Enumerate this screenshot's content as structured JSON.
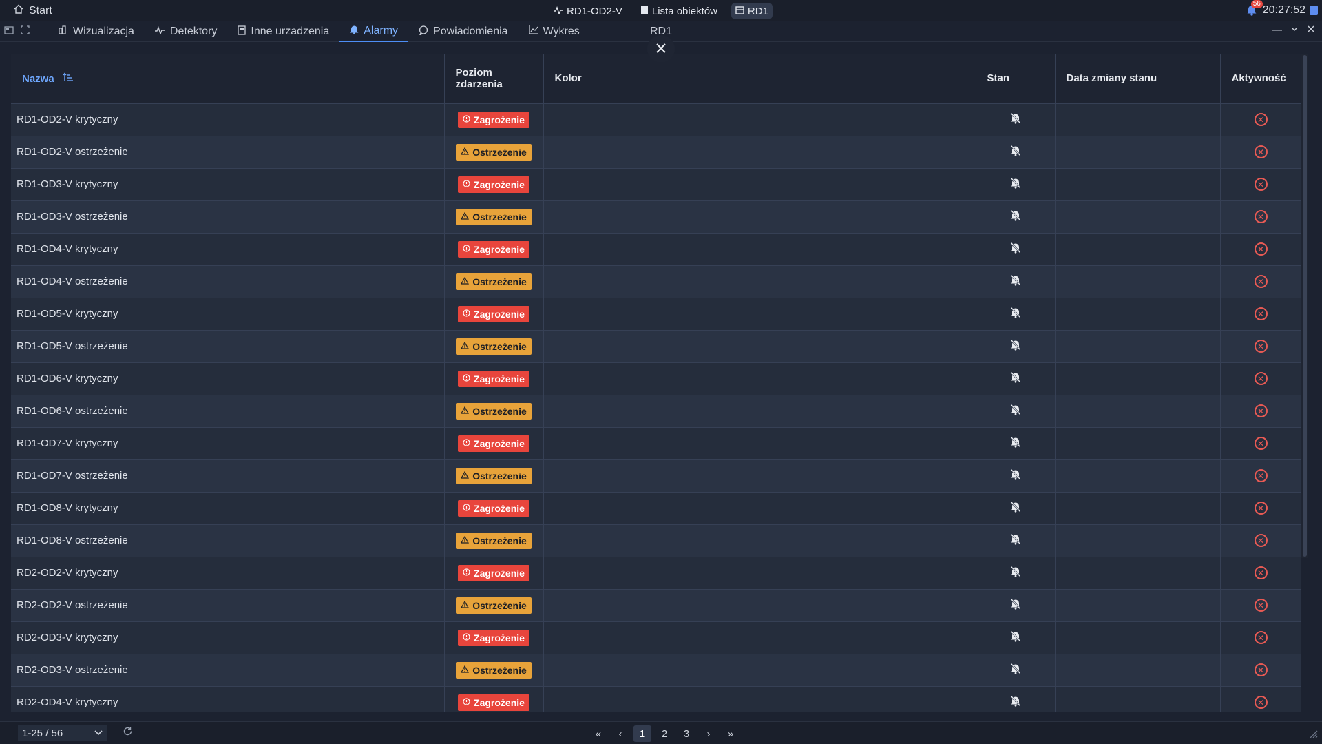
{
  "topbar": {
    "start_label": "Start",
    "breadcrumbs": [
      {
        "label": "RD1-OD2-V",
        "icon": "pulse-icon"
      },
      {
        "label": "Lista obiektów",
        "icon": "list-icon"
      },
      {
        "label": "RD1",
        "icon": "device-icon"
      }
    ],
    "notification_count": "56",
    "clock": "20:27:52"
  },
  "tabs": [
    {
      "label": "Wizualizacja",
      "icon": "visualization-icon"
    },
    {
      "label": "Detektory",
      "icon": "pulse-icon"
    },
    {
      "label": "Inne urzadzenia",
      "icon": "device-icon"
    },
    {
      "label": "Alarmy",
      "icon": "bell-icon",
      "active": true
    },
    {
      "label": "Powiadomienia",
      "icon": "chat-icon"
    },
    {
      "label": "Wykres",
      "icon": "chart-icon"
    }
  ],
  "window_title": "RD1",
  "table": {
    "columns": {
      "name": "Nazwa",
      "level": "Poziom zdarzenia",
      "color": "Kolor",
      "state": "Stan",
      "date": "Data zmiany stanu",
      "activity": "Aktywność"
    },
    "rows": [
      {
        "name": "RD1-OD2-V krytyczny",
        "level": "Zagrożenie",
        "type": "crit"
      },
      {
        "name": "RD1-OD2-V ostrzeżenie",
        "level": "Ostrzeżenie",
        "type": "warn"
      },
      {
        "name": "RD1-OD3-V krytyczny",
        "level": "Zagrożenie",
        "type": "crit"
      },
      {
        "name": "RD1-OD3-V ostrzeżenie",
        "level": "Ostrzeżenie",
        "type": "warn"
      },
      {
        "name": "RD1-OD4-V krytyczny",
        "level": "Zagrożenie",
        "type": "crit"
      },
      {
        "name": "RD1-OD4-V ostrzeżenie",
        "level": "Ostrzeżenie",
        "type": "warn"
      },
      {
        "name": "RD1-OD5-V krytyczny",
        "level": "Zagrożenie",
        "type": "crit"
      },
      {
        "name": "RD1-OD5-V ostrzeżenie",
        "level": "Ostrzeżenie",
        "type": "warn"
      },
      {
        "name": "RD1-OD6-V krytyczny",
        "level": "Zagrożenie",
        "type": "crit"
      },
      {
        "name": "RD1-OD6-V ostrzeżenie",
        "level": "Ostrzeżenie",
        "type": "warn"
      },
      {
        "name": "RD1-OD7-V krytyczny",
        "level": "Zagrożenie",
        "type": "crit"
      },
      {
        "name": "RD1-OD7-V ostrzeżenie",
        "level": "Ostrzeżenie",
        "type": "warn"
      },
      {
        "name": "RD1-OD8-V krytyczny",
        "level": "Zagrożenie",
        "type": "crit"
      },
      {
        "name": "RD1-OD8-V ostrzeżenie",
        "level": "Ostrzeżenie",
        "type": "warn"
      },
      {
        "name": "RD2-OD2-V krytyczny",
        "level": "Zagrożenie",
        "type": "crit"
      },
      {
        "name": "RD2-OD2-V ostrzeżenie",
        "level": "Ostrzeżenie",
        "type": "warn"
      },
      {
        "name": "RD2-OD3-V krytyczny",
        "level": "Zagrożenie",
        "type": "crit"
      },
      {
        "name": "RD2-OD3-V ostrzeżenie",
        "level": "Ostrzeżenie",
        "type": "warn"
      },
      {
        "name": "RD2-OD4-V krytyczny",
        "level": "Zagrożenie",
        "type": "crit"
      }
    ]
  },
  "pagination": {
    "range": "1-25 / 56",
    "pages": [
      "1",
      "2",
      "3"
    ],
    "current_page": "1"
  },
  "colors": {
    "accent": "#4d8ef5",
    "critical": "#e8453c",
    "warning": "#e8a33a"
  }
}
